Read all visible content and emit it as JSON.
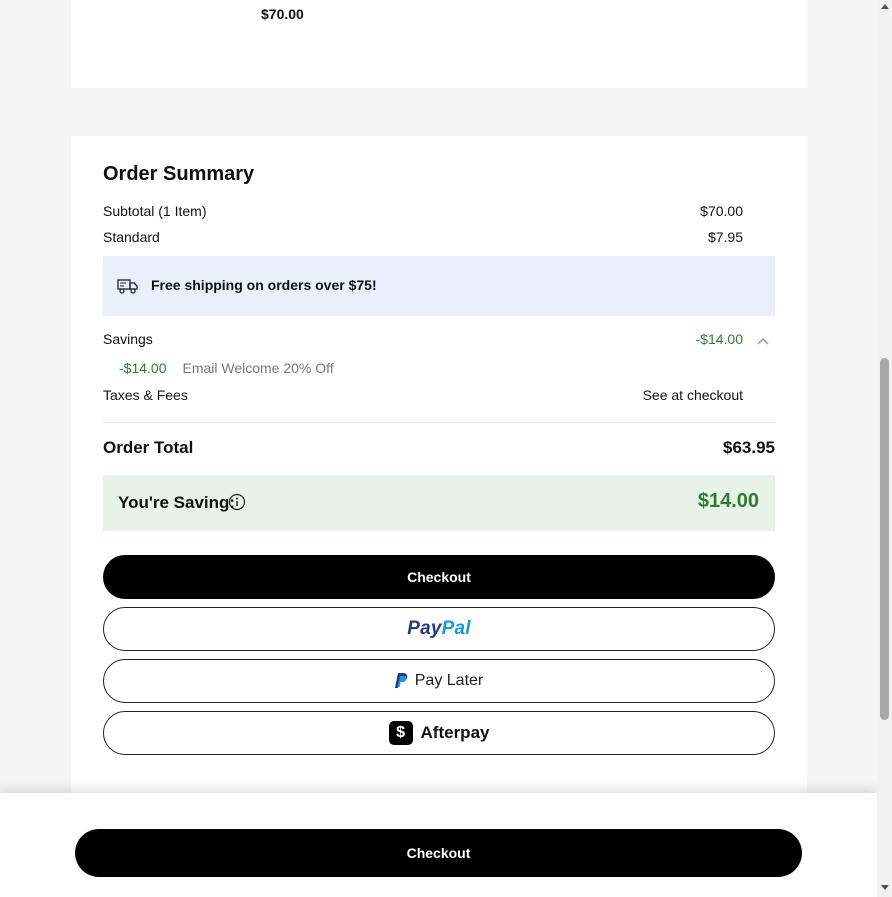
{
  "product": {
    "price": "$70.00"
  },
  "summary": {
    "title": "Order Summary",
    "subtotal_label": "Subtotal (1 Item)",
    "subtotal_value": "$70.00",
    "shipping_label": "Standard",
    "shipping_value": "$7.95",
    "free_shipping_banner": "Free shipping on orders over $75!",
    "savings_label": "Savings",
    "savings_value": "-$14.00",
    "discount_amount": "-$14.00",
    "discount_name": "Email Welcome 20% Off",
    "taxes_label": "Taxes & Fees",
    "taxes_value": "See at checkout",
    "total_label": "Order Total",
    "total_value": "$63.95",
    "saving_label": "You're Saving:",
    "saving_value": "$14.00"
  },
  "buttons": {
    "checkout": "Checkout",
    "paypal_part1": "Pay",
    "paypal_part2": "Pal",
    "pay_later": "Pay Later",
    "afterpay": "Afterpay",
    "sticky_checkout": "Checkout"
  },
  "icons": {
    "truck": "truck-icon",
    "chevron": "chevron-up-icon",
    "info": "info-icon",
    "paypal_p": "paypal-p-icon",
    "cashapp": "dollar-icon"
  },
  "colors": {
    "savings_green": "#2e7d32",
    "banner_blue": "#e8f0fb",
    "saving_box_green": "#e6f3e6",
    "paypal_dark": "#253b80",
    "paypal_light": "#179bd7"
  }
}
